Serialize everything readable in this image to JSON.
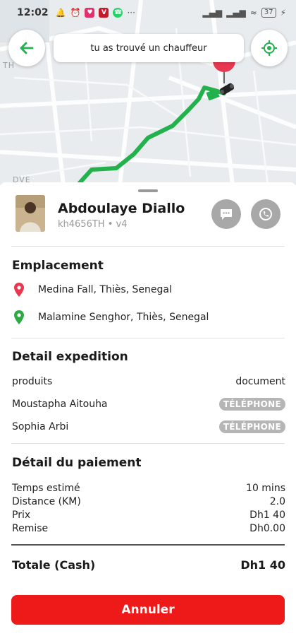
{
  "status_bar": {
    "time": "12:02",
    "battery": "37",
    "more": "···"
  },
  "header": {
    "title": "tu as trouvé un chauffeur"
  },
  "map": {
    "labels": [
      "TH",
      "DVE"
    ],
    "route_color": "#22b14c"
  },
  "driver": {
    "name": "Abdoulaye Diallo",
    "subtitle": "kh4656TH • v4"
  },
  "location": {
    "title": "Emplacement",
    "pickup": "Medina Fall, Thiès, Senegal",
    "dropoff": "Malamine Senghor, Thiès, Senegal"
  },
  "expedition": {
    "title": "Detail expedition",
    "rows": [
      {
        "label": "produits",
        "value": "document"
      },
      {
        "label": "Moustapha Aitouha",
        "value": "TÉLÉPHONE"
      },
      {
        "label": "Sophia Arbi",
        "value": "TÉLÉPHONE"
      }
    ]
  },
  "payment": {
    "title": "Détail du paiement",
    "rows": [
      {
        "label": "Temps estimé",
        "value": "10 mins"
      },
      {
        "label": "Distance (KM)",
        "value": "2.0"
      },
      {
        "label": "Prix",
        "value": "Dh1 40"
      },
      {
        "label": "Remise",
        "value": "Dh0.00"
      }
    ],
    "total_label": "Totale (Cash)",
    "total_value": "Dh1 40"
  },
  "actions": {
    "cancel_label": "Annuler"
  },
  "colors": {
    "accent": "#ee1a1a",
    "route": "#22b14c",
    "pickup_pin": "#e8384f",
    "dropoff_pin": "#2eaa44"
  }
}
